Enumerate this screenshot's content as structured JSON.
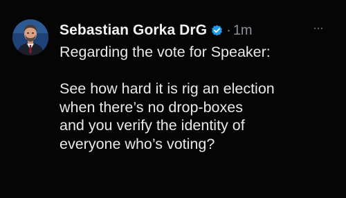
{
  "tweet": {
    "author_name": "Sebastian Gorka DrG",
    "separator": "·",
    "timestamp": "1m",
    "more_label": "···",
    "first_line": "Regarding the vote for Speaker:",
    "body_lines": [
      "See how hard it is rig an election",
      "when there’s no drop-boxes",
      "and you verify the identity of",
      "everyone who’s voting?"
    ]
  },
  "icons": {
    "avatar": "profile-photo",
    "verified": "verified-badge-icon",
    "more": "more-options-icon"
  },
  "colors": {
    "background": "#050505",
    "text": "#e7e9ea",
    "secondary": "#8b9198",
    "verified": "#1d9bf0"
  }
}
